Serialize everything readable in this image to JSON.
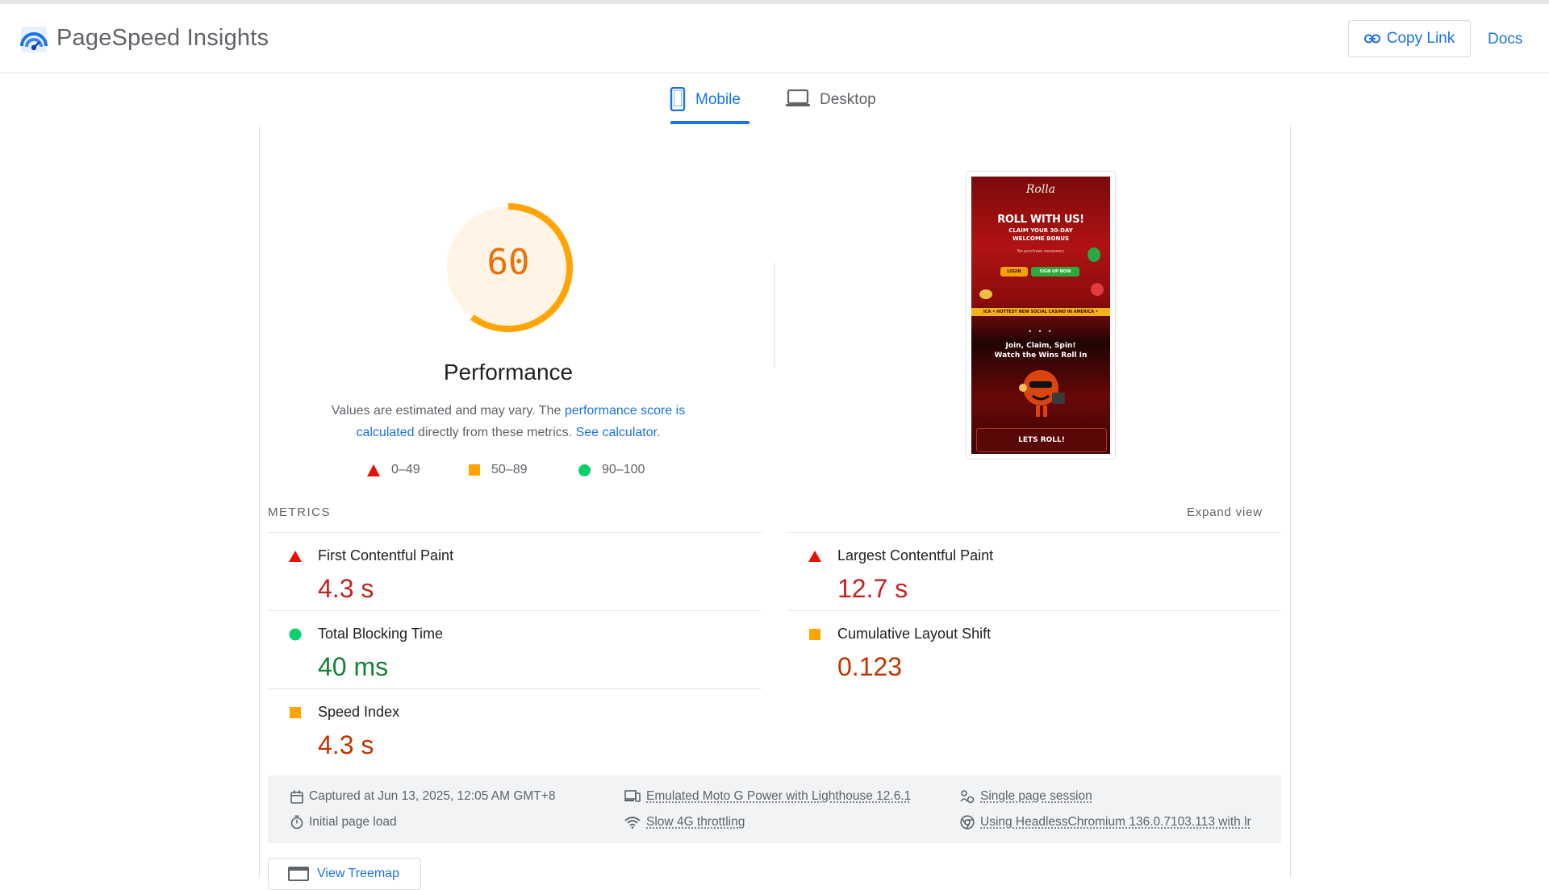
{
  "header": {
    "app_title": "PageSpeed Insights",
    "copy_link_label": "Copy Link",
    "docs_label": "Docs",
    "logo_icon": "pagespeed-logo-icon",
    "link_icon": "link-icon"
  },
  "tabs": [
    {
      "label": "Mobile",
      "icon": "phone-icon",
      "active": true
    },
    {
      "label": "Desktop",
      "icon": "laptop-icon",
      "active": false
    }
  ],
  "performance": {
    "score": "60",
    "score_value": 60,
    "title": "Performance",
    "desc_pre": "Values are estimated and may vary. The ",
    "desc_link1": "performance score is calculated",
    "desc_mid": " directly from these metrics. ",
    "desc_link2": "See calculator",
    "desc_end": ".",
    "legend": [
      {
        "label": "0–49",
        "shape": "triangle",
        "color": "#eb0f00"
      },
      {
        "label": "50–89",
        "shape": "square",
        "color": "#ffa400"
      },
      {
        "label": "90–100",
        "shape": "circle",
        "color": "#0cce6b"
      }
    ],
    "gauge_color": "#ffa400",
    "gauge_bg": "#fff3e0"
  },
  "screenshot": {
    "logo": "Rolla",
    "headline": "ROLL WITH US!",
    "sub": "CLAIM YOUR 30-DAY WELCOME BONUS",
    "small": "No purchase necessary",
    "login": "LOGIN",
    "signup": "SIGN UP NOW",
    "ticker": "ICA  •  HOTTEST NEW SOCIAL CASINO IN AMERICA  •",
    "dots": "• • •",
    "tagline_1": "Join, Claim, Spin!",
    "tagline_2": "Watch the Wins Roll In",
    "cta": "LETS ROLL!"
  },
  "metrics": {
    "section_label": "METRICS",
    "expand_label": "Expand view",
    "items": [
      {
        "name": "First Contentful Paint",
        "value": "4.3 s",
        "rating": "poor"
      },
      {
        "name": "Largest Contentful Paint",
        "value": "12.7 s",
        "rating": "poor"
      },
      {
        "name": "Total Blocking Time",
        "value": "40 ms",
        "rating": "good"
      },
      {
        "name": "Cumulative Layout Shift",
        "value": "0.123",
        "rating": "average"
      },
      {
        "name": "Speed Index",
        "value": "4.3 s",
        "rating": "average"
      }
    ],
    "colors": {
      "poor": "#eb0f00",
      "average": "#ffa400",
      "good": "#0cce6b"
    }
  },
  "footer": {
    "captured": "Captured at Jun 13, 2025, 12:05 AM GMT+8",
    "load": "Initial page load",
    "device": "Emulated Moto G Power with Lighthouse 12.6.1",
    "throttling": "Slow 4G throttling",
    "session": "Single page session",
    "browser": "Using HeadlessChromium 136.0.7103.113 with lr"
  },
  "treemap": {
    "label": "View Treemap"
  }
}
